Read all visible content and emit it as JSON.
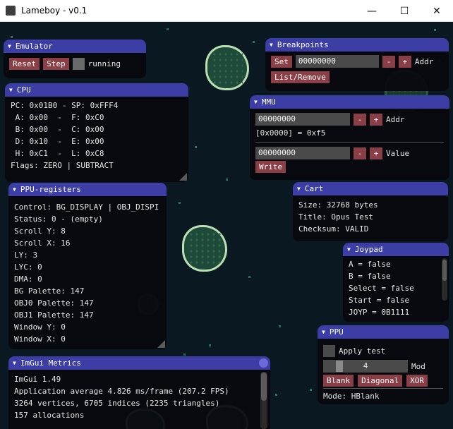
{
  "window": {
    "title": "Lameboy - v0.1",
    "minimize": "—",
    "maximize": "☐",
    "close": "✕"
  },
  "emulator": {
    "title": "Emulator",
    "reset": "Reset",
    "step": "Step",
    "running": "running"
  },
  "cpu": {
    "title": "CPU",
    "lines": [
      "PC: 0x01B0 - SP: 0xFFF4",
      " A: 0x00  -  F: 0xC0",
      " B: 0x00  -  C: 0x00",
      " D: 0x10  -  E: 0x00",
      " H: 0xC1  -  L: 0xC8",
      "Flags: ZERO | SUBTRACT"
    ]
  },
  "ppu_registers": {
    "title": "PPU-registers",
    "lines": [
      "Control: BG_DISPLAY | OBJ_DISPI",
      "Status: 0 - (empty)",
      "Scroll Y: 8",
      "Scroll X: 16",
      "LY: 3",
      "LYC: 0",
      "DMA: 0",
      "BG Palette: 147",
      "OBJ0 Palette: 147",
      "OBJ1 Palette: 147",
      "Window Y: 0",
      "Window X: 0"
    ]
  },
  "metrics": {
    "title": "ImGui Metrics",
    "lines": [
      "ImGui 1.49",
      "Application average 4.826 ms/frame (207.2 FPS)",
      "3264 vertices, 6705 indices (2235 triangles)",
      "157 allocations"
    ]
  },
  "breakpoints": {
    "title": "Breakpoints",
    "set": "Set",
    "addr_value": "00000000",
    "minus": "-",
    "plus": "+",
    "addr_label": "Addr",
    "list_remove": "List/Remove"
  },
  "mmu": {
    "title": "MMU",
    "addr_value": "00000000",
    "minus": "-",
    "plus": "+",
    "addr_label": "Addr",
    "read_line": "[0x0000] = 0xf5",
    "value_value": "00000000",
    "value_label": "Value",
    "write": "Write"
  },
  "cart": {
    "title": "Cart",
    "lines": [
      "Size: 32768 bytes",
      "Title: Opus Test",
      "Checksum: VALID"
    ]
  },
  "joypad": {
    "title": "Joypad",
    "lines": [
      "A = false",
      "B = false",
      "Select = false",
      "Start = false",
      "JOYP = 0B1111"
    ]
  },
  "ppu": {
    "title": "PPU",
    "apply_test": "Apply test",
    "slider_value": "4",
    "mod_label": "Mod",
    "blank": "Blank",
    "diagonal": "Diagonal",
    "xor": "XOR",
    "mode": "Mode: HBlank"
  }
}
